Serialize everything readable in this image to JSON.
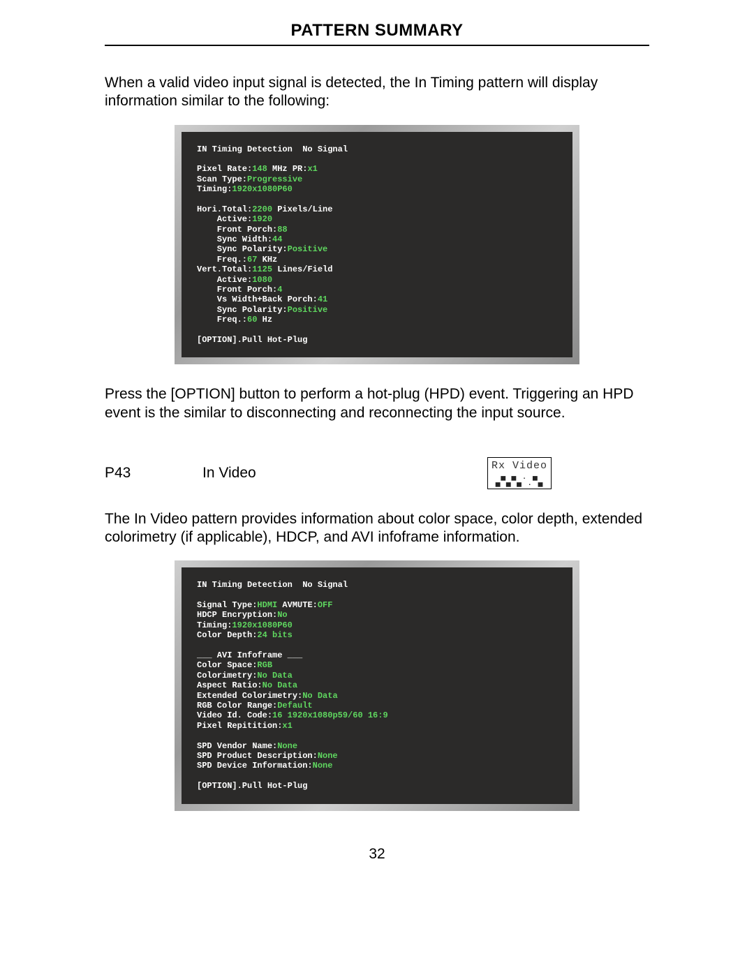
{
  "header": {
    "title": "PATTERN SUMMARY"
  },
  "intro_text": "When a valid video input signal is detected, the In Timing pattern will display information similar to the following:",
  "screen1": {
    "l01a": "IN Timing Detection  No Signal",
    "l02a": "Pixel Rate:",
    "l02b": "148",
    "l02c": " MHz PR:",
    "l02d": "x1",
    "l03a": "Scan Type:",
    "l03b": "Progressive",
    "l04a": "Timing:",
    "l04b": "1920x1080P60",
    "l05a": "Hori.Total:",
    "l05b": "2200",
    "l05c": " Pixels/Line",
    "l06a": "    Active:",
    "l06b": "1920",
    "l07a": "    Front Porch:",
    "l07b": "88",
    "l08a": "    Sync Width:",
    "l08b": "44",
    "l09a": "    Sync Polarity:",
    "l09b": "Positive",
    "l10a": "    Freq.:",
    "l10b": "67",
    "l10c": " KHz",
    "l11a": "Vert.Total:",
    "l11b": "1125",
    "l11c": " Lines/Field",
    "l12a": "    Active:",
    "l12b": "1080",
    "l13a": "    Front Porch:",
    "l13b": "4",
    "l14a": "    Vs Width+Back Porch:",
    "l14b": "41",
    "l15a": "    Sync Polarity:",
    "l15b": "Positive",
    "l16a": "    Freq.:",
    "l16b": "60",
    "l16c": " Hz",
    "l17a": "[OPTION].Pull Hot-Plug"
  },
  "mid_text": "Press the [OPTION] button to perform a hot-plug (HPD) event.  Triggering an HPD event is the similar to disconnecting and reconnecting the input source.",
  "pattern": {
    "id": "P43",
    "name": "In Video",
    "icon_label": "Rx Video"
  },
  "desc_text": "The In Video pattern provides information about color space, color depth, extended colorimetry (if applicable), HDCP, and AVI infoframe information.",
  "screen2": {
    "l01a": "IN Timing Detection  No Signal",
    "l02a": "Signal Type:",
    "l02b": "HDMI",
    "l02c": " AVMUTE:",
    "l02d": "OFF",
    "l03a": "HDCP Encryption:",
    "l03b": "No",
    "l04a": "Timing:",
    "l04b": "1920x1080P60",
    "l05a": "Color Depth:",
    "l05b": "24 bits",
    "l06a": "___ AVI Infoframe ___",
    "l07a": "Color Space:",
    "l07b": "RGB",
    "l08a": "Colorimetry:",
    "l08b": "No Data",
    "l09a": "Aspect Ratio:",
    "l09b": "No Data",
    "l10a": "Extended Colorimetry:",
    "l10b": "No Data",
    "l11a": "RGB Color Range:",
    "l11b": "Default",
    "l12a": "Video Id. Code:",
    "l12b": "16 1920x1080p59/60 16:9",
    "l13a": "Pixel Repitition:",
    "l13b": "x1",
    "l14a": "SPD Vendor Name:",
    "l14b": "None",
    "l15a": "SPD Product Description:",
    "l15b": "None",
    "l16a": "SPD Device Information:",
    "l16b": "None",
    "l17a": "[OPTION].Pull Hot-Plug"
  },
  "page_number": "32"
}
